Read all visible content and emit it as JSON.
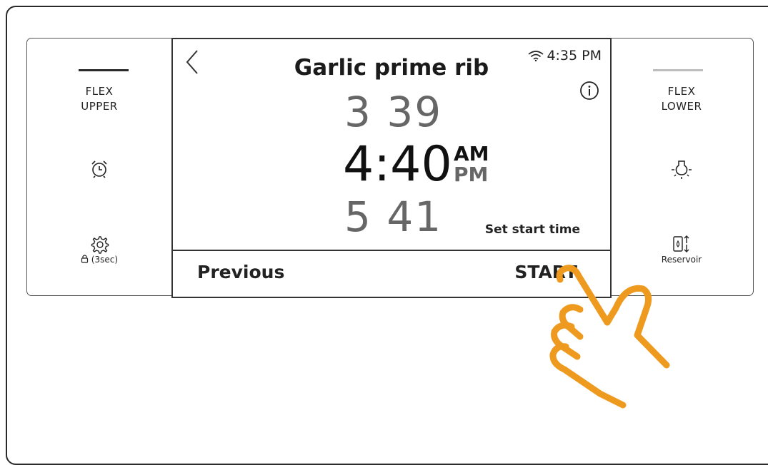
{
  "left_column": {
    "zone_label_line1": "FLEX",
    "zone_label_line2": "UPPER",
    "zone_bar_color": "#2a2a2a",
    "timer_icon": "alarm-clock-icon",
    "settings_icon": "gear-icon",
    "lock_icon": "lock-icon",
    "lock_hold_label": "(3sec)"
  },
  "right_column": {
    "zone_label_line1": "FLEX",
    "zone_label_line2": "LOWER",
    "zone_bar_color": "#bdbdbd",
    "light_icon": "light-bulb-icon",
    "reservoir_icon": "water-reservoir-icon",
    "reservoir_label": "Reservoir"
  },
  "screen": {
    "title": "Garlic prime rib",
    "clock": "4:35 PM",
    "wifi_icon": "wifi-icon",
    "info_icon": "info-icon",
    "back_icon": "back-chevron-icon",
    "time_previous": "3 39",
    "time_selected": "4:40",
    "time_next": "5 41",
    "am_label": "AM",
    "pm_label": "PM",
    "set_start_label": "Set start time",
    "previous_label": "Previous",
    "start_label": "START"
  },
  "colors": {
    "hand_outline": "#ee9a1f"
  }
}
